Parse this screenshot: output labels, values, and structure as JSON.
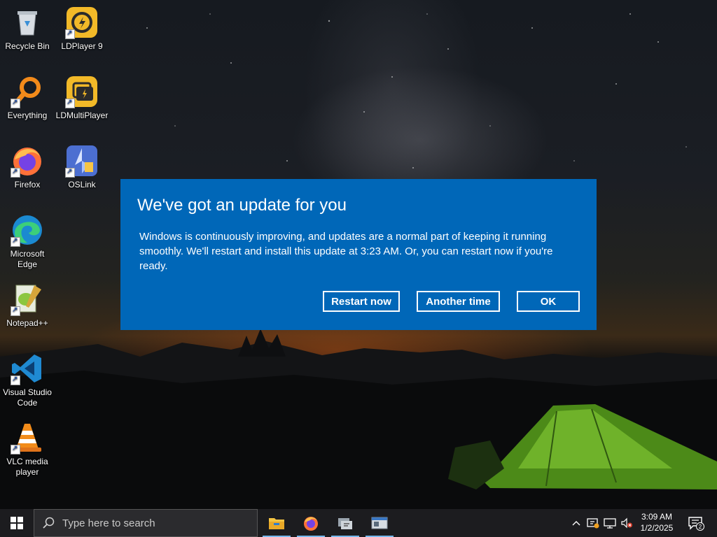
{
  "desktop": {
    "icons": [
      {
        "label": "Recycle Bin",
        "icon": "recycle-bin-icon"
      },
      {
        "label": "LDPlayer 9",
        "icon": "ldplayer-icon"
      },
      {
        "label": "Everything",
        "icon": "everything-icon"
      },
      {
        "label": "LDMultiPlayer",
        "icon": "ldmultiplayer-icon"
      },
      {
        "label": "Firefox",
        "icon": "firefox-icon"
      },
      {
        "label": "OSLink",
        "icon": "oslink-icon"
      },
      {
        "label": "Microsoft Edge",
        "icon": "edge-icon"
      },
      {
        "label": "Notepad++",
        "icon": "notepadpp-icon"
      },
      {
        "label": "Visual Studio Code",
        "icon": "vscode-icon"
      },
      {
        "label": "VLC media player",
        "icon": "vlc-icon"
      }
    ]
  },
  "dialog": {
    "title": "We've got an update for you",
    "message": "Windows is continuously improving, and updates are a normal part of keeping it running smoothly. We'll restart and install this update at 3:23 AM. Or, you can restart now if you're ready.",
    "buttons": {
      "restart": "Restart now",
      "another": "Another time",
      "ok": "OK"
    },
    "color": "#0067b8"
  },
  "taskbar": {
    "search_placeholder": "Type here to search",
    "apps": [
      "file-explorer-icon",
      "firefox-icon",
      "app-icon",
      "window-app-icon"
    ],
    "tray_icons": [
      "chevron-up-icon",
      "security-icon",
      "network-icon",
      "volume-muted-icon"
    ],
    "time": "3:09 AM",
    "date": "1/2/2025",
    "notification_count": "2"
  }
}
